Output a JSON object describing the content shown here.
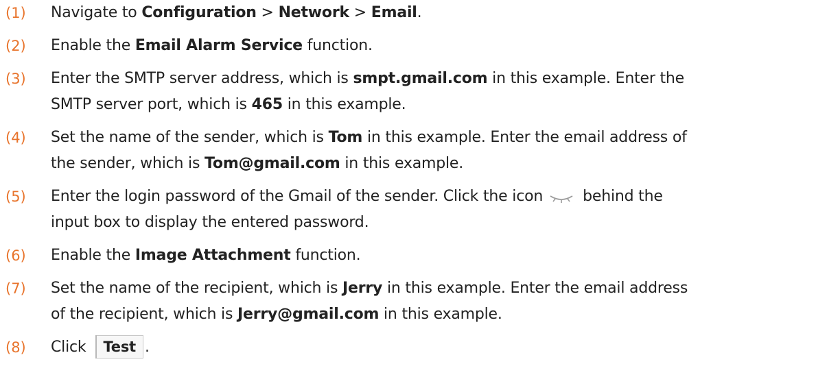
{
  "steps": [
    {
      "num": "(1)",
      "lines": [
        [
          {
            "t": "Navigate to ",
            "b": false
          },
          {
            "t": "Configuration",
            "b": true
          },
          {
            "t": " > ",
            "b": false
          },
          {
            "t": "Network",
            "b": true
          },
          {
            "t": " > ",
            "b": false
          },
          {
            "t": "Email",
            "b": true
          },
          {
            "t": ".",
            "b": false
          }
        ]
      ]
    },
    {
      "num": "(2)",
      "lines": [
        [
          {
            "t": "Enable the ",
            "b": false
          },
          {
            "t": "Email Alarm Service",
            "b": true
          },
          {
            "t": " function.",
            "b": false
          }
        ]
      ]
    },
    {
      "num": "(3)",
      "lines": [
        [
          {
            "t": "Enter the SMTP server address, which is ",
            "b": false
          },
          {
            "t": "smpt.gmail.com",
            "b": true
          },
          {
            "t": " in this example. Enter the",
            "b": false
          }
        ],
        [
          {
            "t": "SMTP server port, which is ",
            "b": false
          },
          {
            "t": "465",
            "b": true
          },
          {
            "t": " in this example.",
            "b": false
          }
        ]
      ]
    },
    {
      "num": "(4)",
      "lines": [
        [
          {
            "t": "Set the name of the sender, which is ",
            "b": false
          },
          {
            "t": "Tom",
            "b": true
          },
          {
            "t": " in this example. Enter the email address of",
            "b": false
          }
        ],
        [
          {
            "t": "the sender, which is ",
            "b": false
          },
          {
            "t": "Tom@gmail.com",
            "b": true
          },
          {
            "t": " in this example.",
            "b": false
          }
        ]
      ]
    },
    {
      "num": "(5)",
      "lines": [
        [
          {
            "t": "Enter the login password of the Gmail of the sender. Click the icon",
            "b": false
          },
          {
            "icon": "eye-closed-icon"
          },
          {
            "t": "behind the",
            "b": false
          }
        ],
        [
          {
            "t": "input box to display the entered password.",
            "b": false
          }
        ]
      ]
    },
    {
      "num": "(6)",
      "lines": [
        [
          {
            "t": "Enable the ",
            "b": false
          },
          {
            "t": "Image Attachment",
            "b": true
          },
          {
            "t": " function.",
            "b": false
          }
        ]
      ]
    },
    {
      "num": "(7)",
      "lines": [
        [
          {
            "t": "Set the name of the recipient, which is ",
            "b": false
          },
          {
            "t": "Jerry",
            "b": true
          },
          {
            "t": " in this example. Enter the email address",
            "b": false
          }
        ],
        [
          {
            "t": "of the recipient, which is ",
            "b": false
          },
          {
            "t": "Jerry@gmail.com",
            "b": true
          },
          {
            "t": " in this example.",
            "b": false
          }
        ]
      ]
    },
    {
      "num": "(8)",
      "lines": [
        [
          {
            "t": "Click",
            "b": false
          },
          {
            "button": "Test"
          },
          {
            "t": ".",
            "b": false
          }
        ]
      ]
    }
  ],
  "colors": {
    "step_number": "#E8742C",
    "text": "#222222"
  }
}
